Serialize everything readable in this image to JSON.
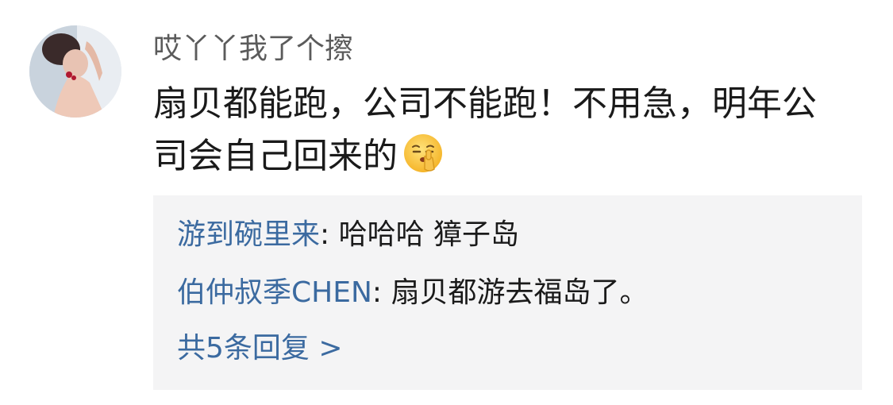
{
  "comment": {
    "username": "哎丫丫我了个擦",
    "text_line1": "扇贝都能跑，公司不能跑！不用急，明年公",
    "text_line2": "司会自己回来的",
    "emoji": "shushing-face-emoji"
  },
  "replies": [
    {
      "user": "游到碗里来",
      "separator": ": ",
      "text": "哈哈哈 獐子岛"
    },
    {
      "user": "伯仲叔季CHEN",
      "separator": ": ",
      "text": "扇贝都游去福岛了。"
    }
  ],
  "more_replies_label": "共5条回复 >",
  "colors": {
    "link_blue": "#3b6aa0",
    "reply_bg": "#f4f4f5",
    "username_gray": "#5b5b5b",
    "text": "#1a1a1a"
  }
}
